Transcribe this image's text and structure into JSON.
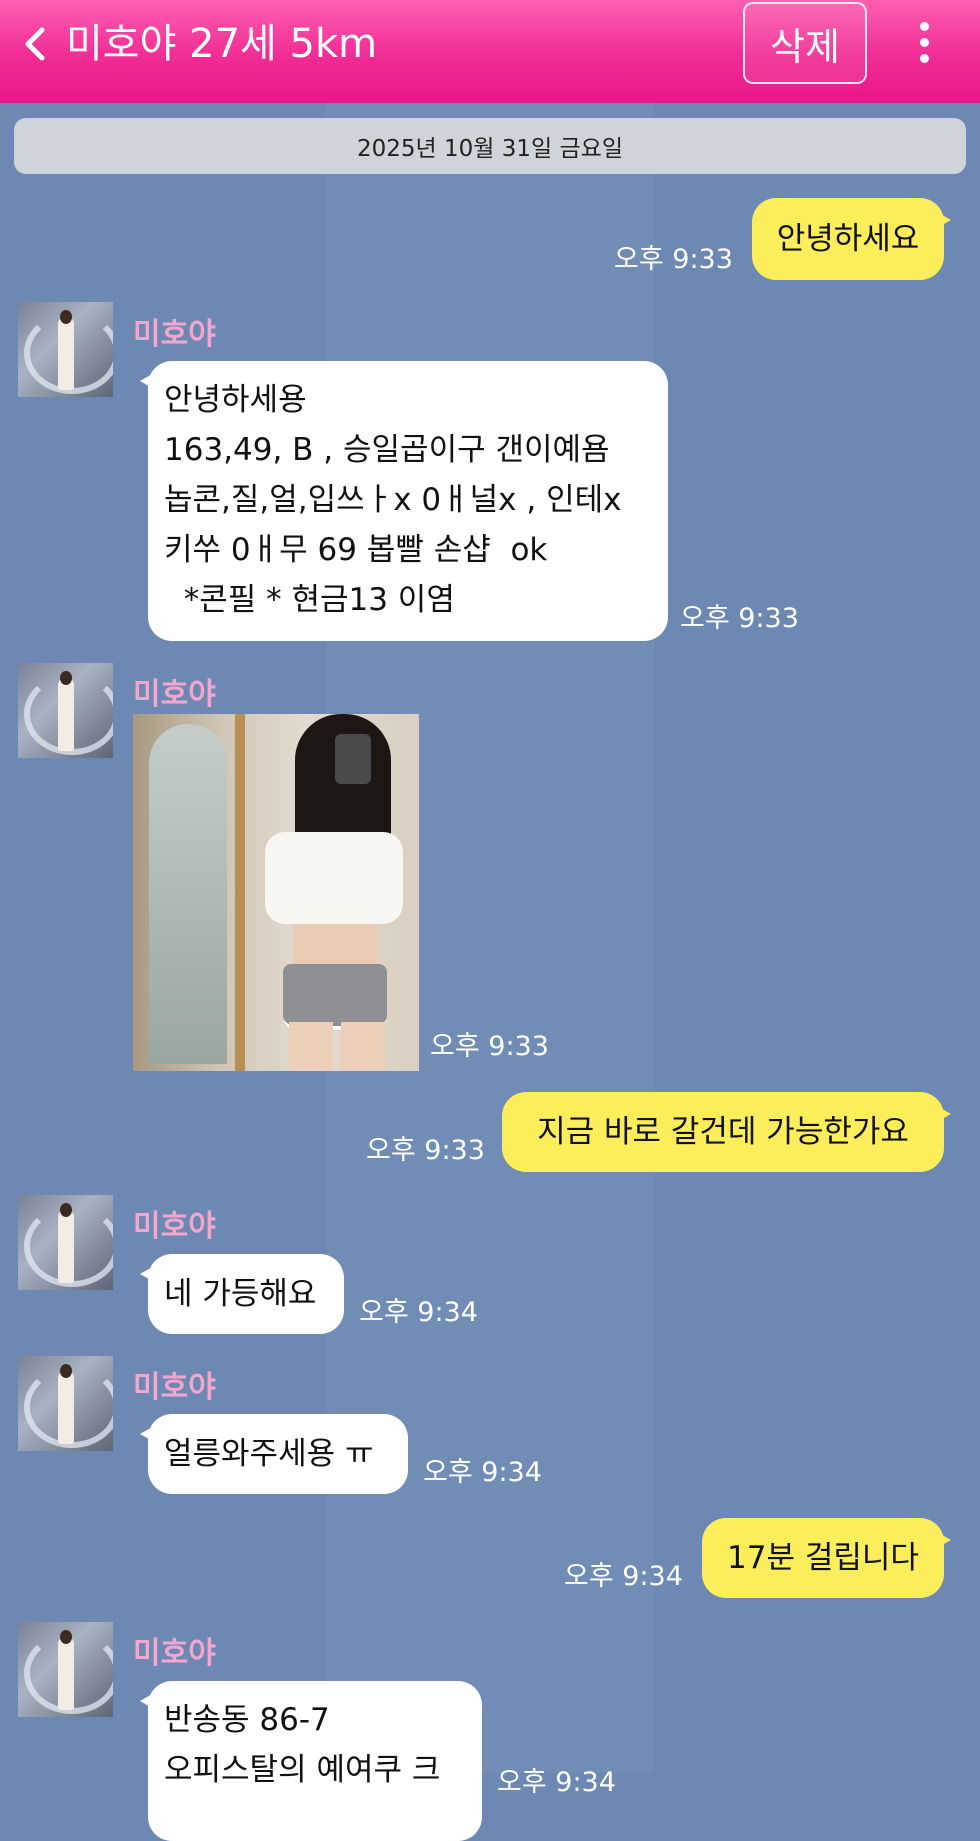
{
  "header": {
    "title": "미호야 27세 5km",
    "delete_label": "삭제",
    "accent_color": "#f02c95"
  },
  "date_banner": "2025년 10월 31일 금요일",
  "contact": {
    "name": "미호야"
  },
  "messages": [
    {
      "side": "out",
      "text": "안녕하세요",
      "time": "오후 9:33"
    },
    {
      "side": "in",
      "sender": "미호야",
      "lines": [
        "안녕하세용",
        "163,49, B , 승일곱이구 갠이예욤",
        "놉콘,질,얼,입쓰ㅏx 0ㅐ널x , 인테x",
        "키쑤 0ㅐ무 69 봅빨 손샵  ok",
        "  *콘필 * 현금13 이염"
      ],
      "time": "오후 9:33"
    },
    {
      "side": "in",
      "sender": "미호야",
      "type": "photo",
      "time": "오후 9:33"
    },
    {
      "side": "out",
      "text": "지금 바로 갈건데 가능한가요",
      "time": "오후 9:33"
    },
    {
      "side": "in",
      "sender": "미호야",
      "text": "네 가등해요",
      "time": "오후 9:34"
    },
    {
      "side": "in",
      "sender": "미호야",
      "text": "얼릉와주세용 ㅠ",
      "time": "오후 9:34"
    },
    {
      "side": "out",
      "text": "17분 걸립니다",
      "time": "오후 9:34"
    },
    {
      "side": "in",
      "sender": "미호야",
      "lines": [
        "반송동 86-7",
        "오피스탈의 예여쿠 크"
      ],
      "time": "오후 9:34"
    }
  ]
}
